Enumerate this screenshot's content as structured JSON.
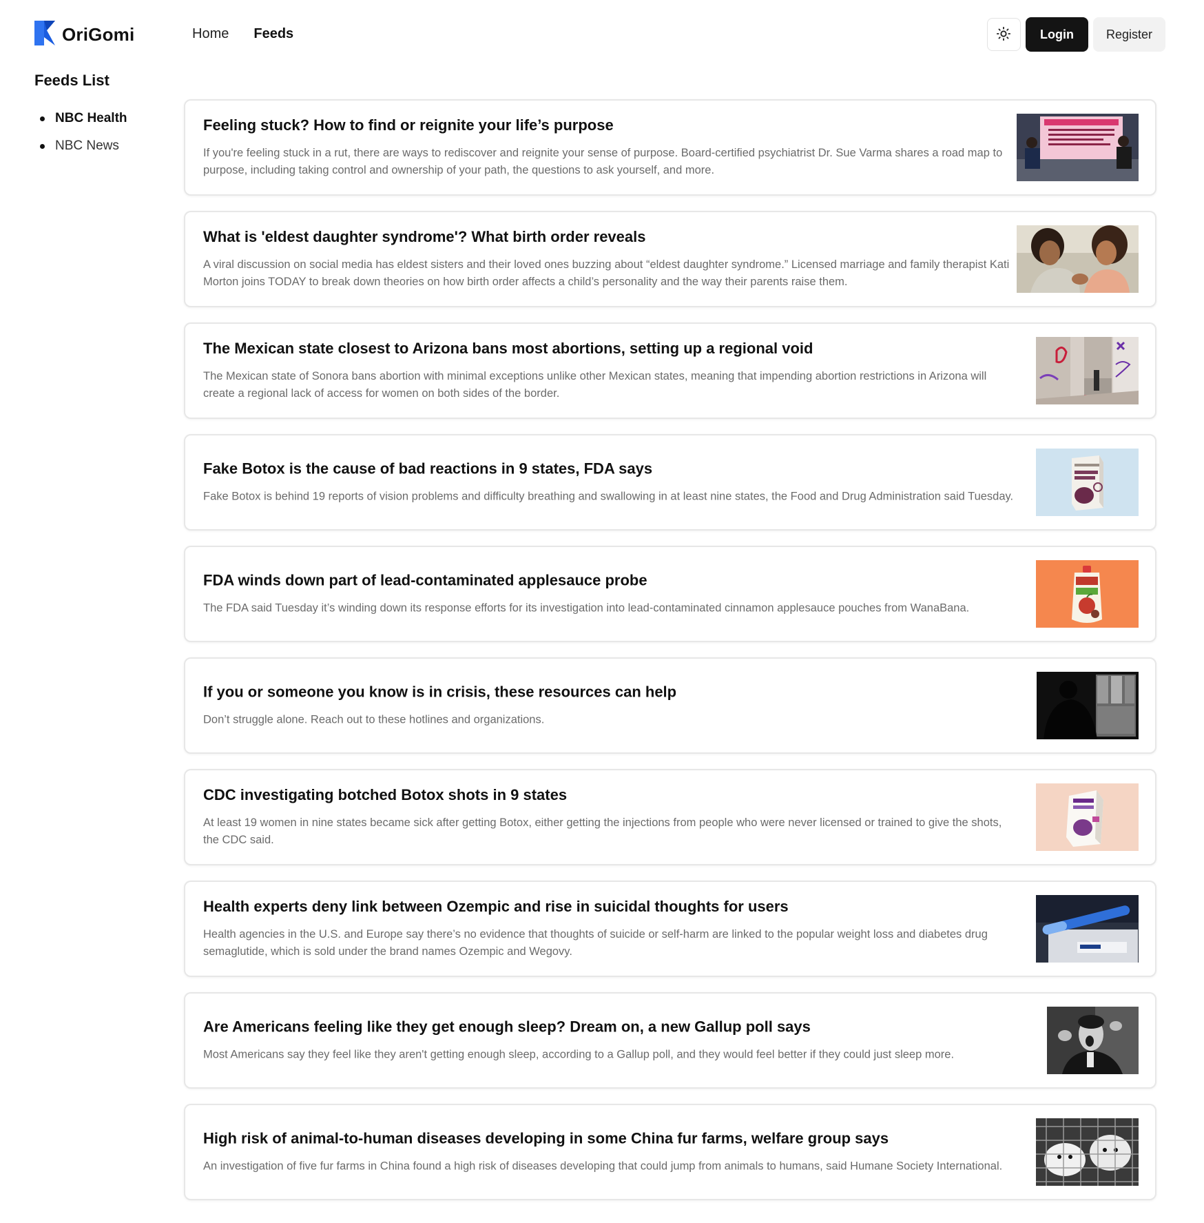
{
  "header": {
    "brand": "OriGomi",
    "nav": [
      {
        "label": "Home",
        "active": false
      },
      {
        "label": "Feeds",
        "active": true
      }
    ],
    "theme_icon": "sun-icon",
    "login_label": "Login",
    "register_label": "Register"
  },
  "sidebar": {
    "title": "Feeds List",
    "items": [
      {
        "label": "NBC Health",
        "active": true
      },
      {
        "label": "NBC News",
        "active": false
      }
    ]
  },
  "feed": [
    {
      "title": "Feeling stuck? How to find or reignite your life’s purpose",
      "description": "If you're feeling stuck in a rut, there are ways to rediscover and reignite your sense of purpose. Board-certified psychiatrist Dr. Sue Varma shares a road map to purpose, including taking control and ownership of your path, the questions to ask yourself, and more.",
      "image_alt": "Two women talking on a TV set with a Road Map to Purpose screen"
    },
    {
      "title": "What is 'eldest daughter syndrome'? What birth order reveals",
      "description": "A viral discussion on social media has eldest sisters and their loved ones buzzing about “eldest daughter syndrome.” Licensed marriage and family therapist Kati Morton joins TODAY to break down theories on how birth order affects a child’s personality and the way their parents raise them.",
      "image_alt": "Two sisters laughing together"
    },
    {
      "title": "The Mexican state closest to Arizona bans most abortions, setting up a regional void",
      "description": "The Mexican state of Sonora bans abortion with minimal exceptions unlike other Mexican states, meaning that impending abortion restrictions in Arizona will create a regional lack of access for women on both sides of the border.",
      "image_alt": "Graffiti-covered building with a protester"
    },
    {
      "title": "Fake Botox is the cause of bad reactions in 9 states, FDA says",
      "description": "Fake Botox is behind 19 reports of vision problems and difficulty breathing and swallowing in at least nine states, the Food and Drug Administration said Tuesday.",
      "image_alt": "Botox box on light blue background"
    },
    {
      "title": "FDA winds down part of lead-contaminated applesauce probe",
      "description": "The FDA said Tuesday it’s winding down its response efforts for its investigation into lead-contaminated cinnamon applesauce pouches from WanaBana.",
      "image_alt": "Applesauce pouch on orange background"
    },
    {
      "title": "If you or someone you know is in crisis, these resources can help",
      "description": "Don’t struggle alone. Reach out to these hotlines and organizations.",
      "image_alt": "Silhouette of a person by a window"
    },
    {
      "title": "CDC investigating botched Botox shots in 9 states",
      "description": "At least 19 women in nine states became sick after getting Botox, either getting the injections from people who were never licensed or trained to give the shots, the CDC said.",
      "image_alt": "Botox box on peach background"
    },
    {
      "title": "Health experts deny link between Ozempic and rise in suicidal thoughts for users",
      "description": "Health agencies in the U.S. and Europe say there’s no evidence that thoughts of suicide or self-harm are linked to the popular weight loss and diabetes drug semaglutide, which is sold under the brand names Ozempic and Wegovy.",
      "image_alt": "Ozempic injection pen and box"
    },
    {
      "title": "Are Americans feeling like they get enough sleep? Dream on, a new Gallup poll says",
      "description": "Most Americans say they feel like they aren't getting enough sleep, according to a Gallup poll, and they would feel better if they could just sleep more.",
      "image_alt": "Man yawning in black and white"
    },
    {
      "title": "High risk of animal-to-human diseases developing in some China fur farms, welfare group says",
      "description": "An investigation of five fur farms in China found a high risk of diseases developing that could jump from animals to humans, said Humane Society International.",
      "image_alt": "White foxes in wire cages"
    }
  ]
}
